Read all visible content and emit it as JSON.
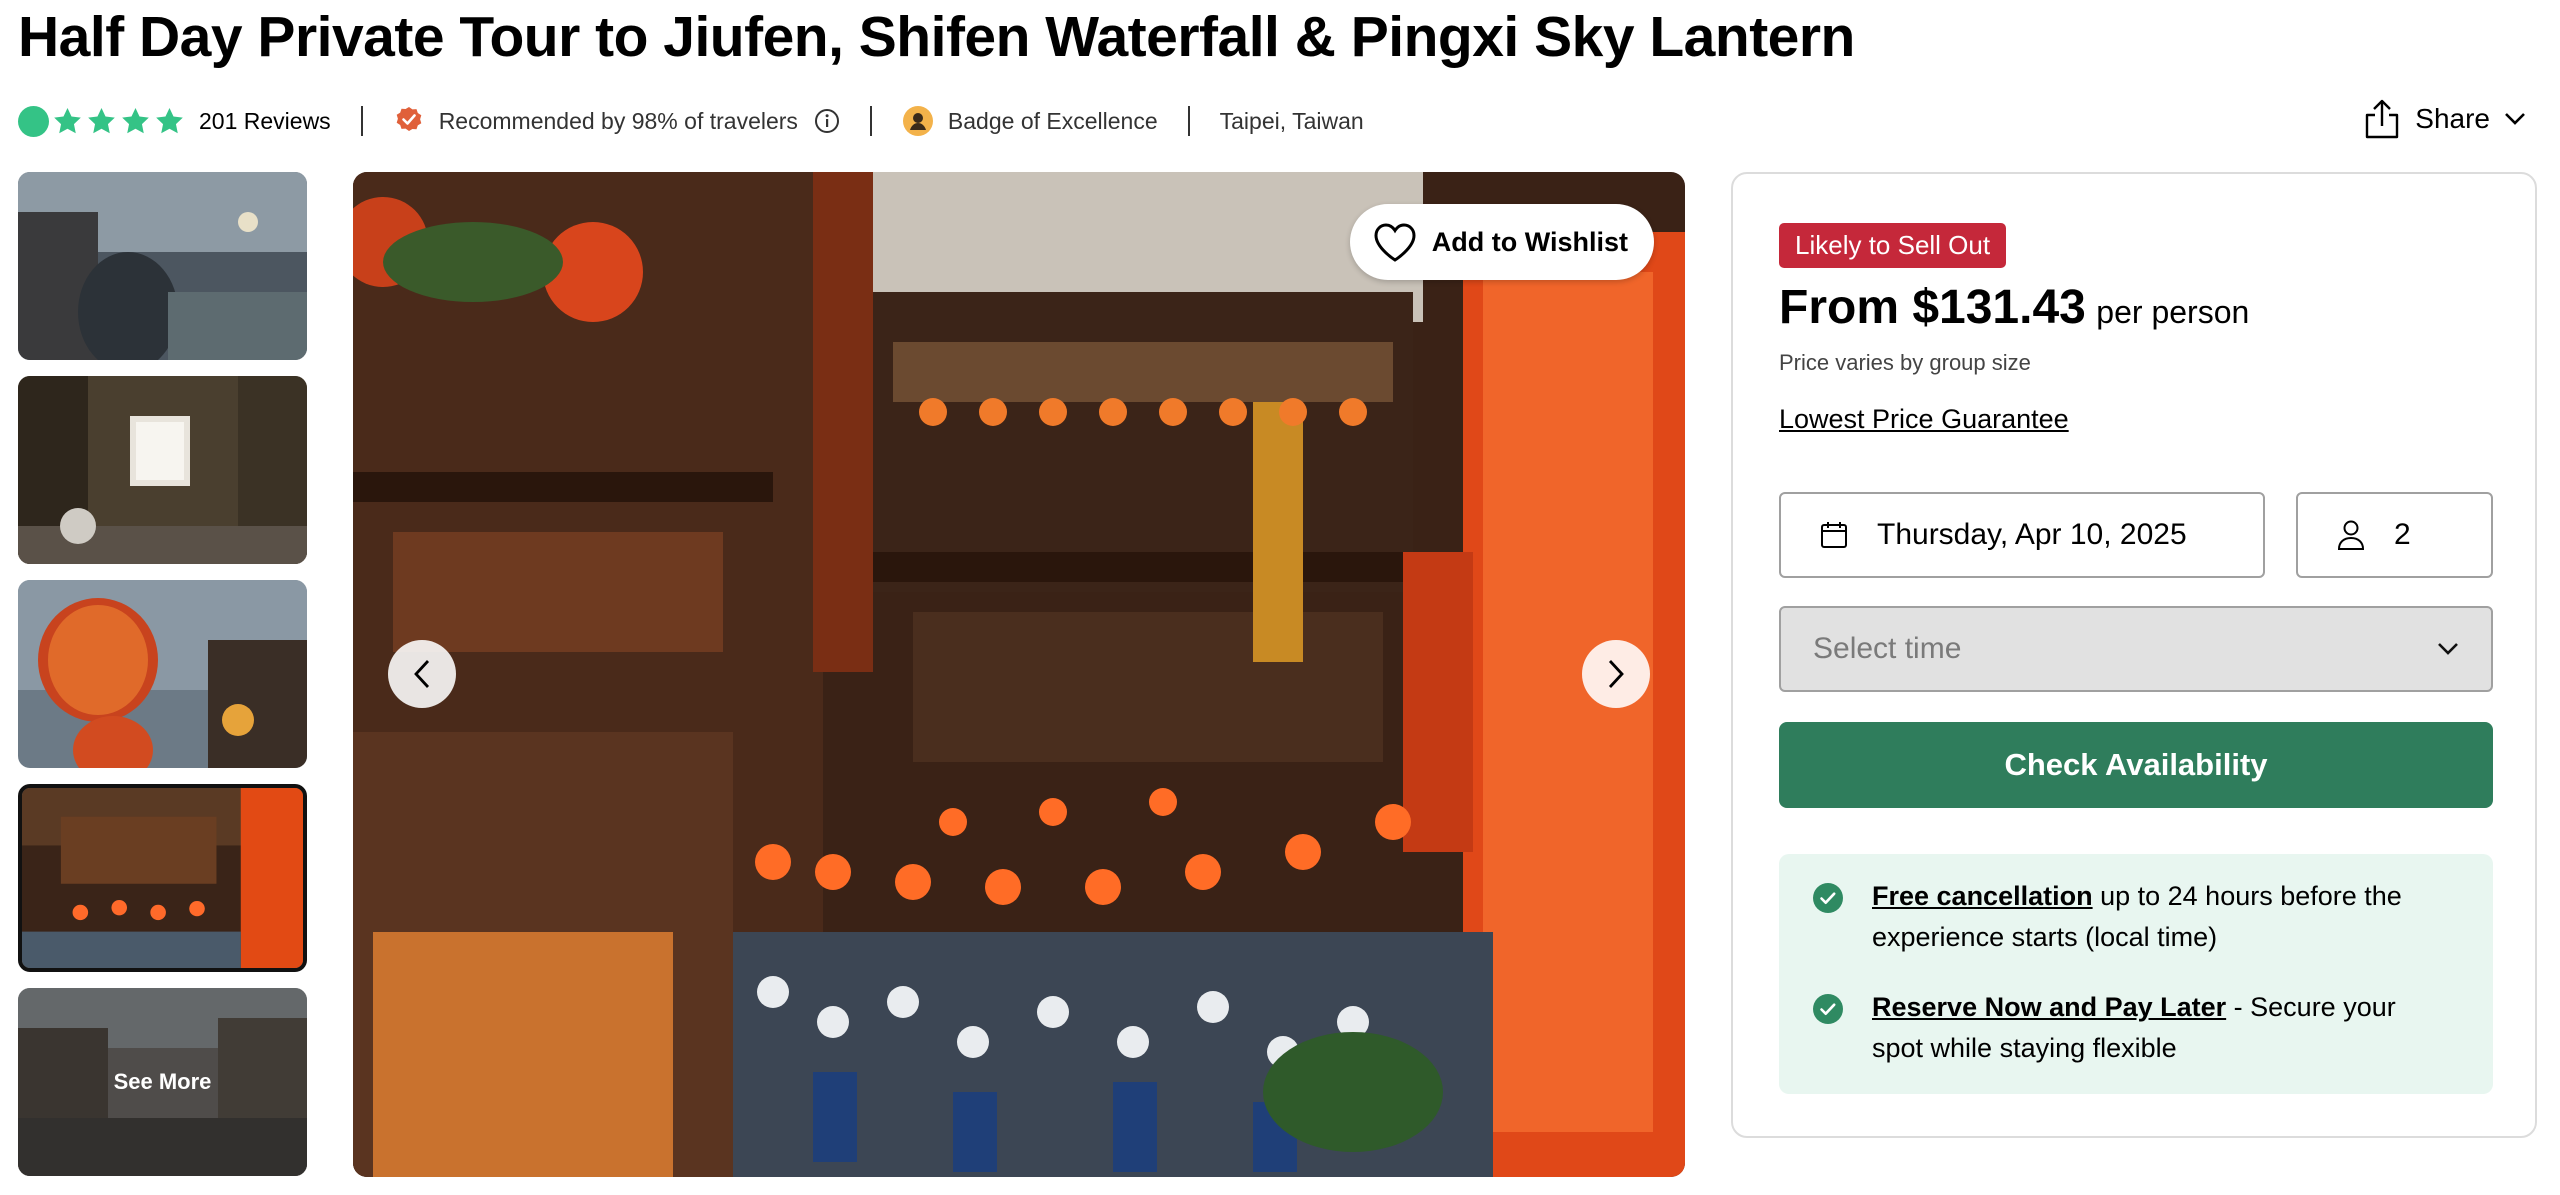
{
  "title": "Half Day Private Tour to Jiufen, Shifen Waterfall & Pingxi Sky Lantern",
  "rating": {
    "stars": 5,
    "reviews_label": "201 Reviews"
  },
  "meta": {
    "recommended": "Recommended by 98% of travelers",
    "badge": "Badge of Excellence",
    "location": "Taipei, Taiwan"
  },
  "share_label": "Share",
  "gallery": {
    "see_more": "See More",
    "wishlist_label": "Add to Wishlist",
    "active_thumb_index": 4,
    "thumbnail_count": 5
  },
  "booking": {
    "urgency_badge": "Likely to Sell Out",
    "price": "From $131.43",
    "price_unit": "per person",
    "price_note": "Price varies by group size",
    "guarantee_link": "Lowest Price Guarantee",
    "date_value": "Thursday, Apr 10, 2025",
    "travelers_value": "2",
    "time_placeholder": "Select time",
    "cta_label": "Check Availability",
    "perks": [
      {
        "link": "Free cancellation",
        "text": " up to 24 hours before the experience starts (local time)"
      },
      {
        "link": "Reserve Now and Pay Later",
        "text": " - Secure your spot while staying flexible"
      }
    ]
  },
  "colors": {
    "star_green": "#34c386",
    "sell_out_red": "#c5283a",
    "cta_green": "#2f7d5c",
    "perk_bg": "#e8f6f0",
    "check_green": "#2f8a62"
  }
}
